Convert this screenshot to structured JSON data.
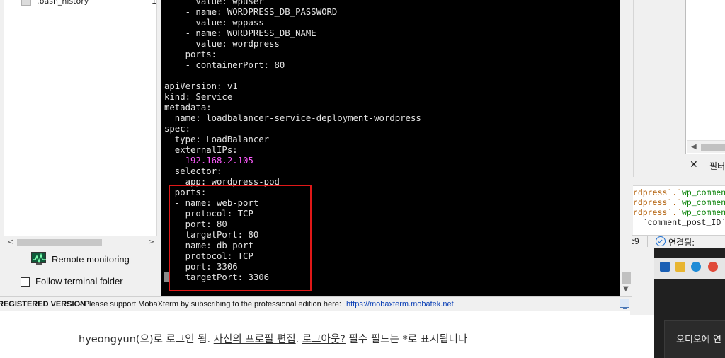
{
  "file_browser": {
    "row": {
      "name": ".bash_history",
      "size": "1"
    }
  },
  "sidebar": {
    "remote_monitoring": "Remote monitoring",
    "follow_terminal_folder": "Follow terminal folder",
    "follow_terminal_folder_checked": false
  },
  "terminal": {
    "lines": [
      "      value: wpuser",
      "    - name: WORDPRESS_DB_PASSWORD",
      "      value: wppass",
      "    - name: WORDPRESS_DB_NAME",
      "      value: wordpress",
      "    ports:",
      "    - containerPort: 80",
      "---",
      "apiVersion: v1",
      "kind: Service",
      "metadata:",
      "  name: loadbalancer-service-deployment-wordpress",
      "spec:",
      "  type: LoadBalancer",
      "  externalIPs:",
      "  - ",
      "  selector:",
      "    app: wordpress-pod",
      "  ports:",
      "  - name: web-port",
      "    protocol: TCP",
      "    port: 80",
      "    targetPort: 80",
      "  - name: db-port",
      "    protocol: TCP",
      "    port: 3306",
      "    targetPort: 3306"
    ],
    "external_ip": "192.168.2.105"
  },
  "statusbar": {
    "registered": "REGISTERED VERSION",
    "message": " -  Please support MobaXterm by subscribing to the professional edition here:",
    "url": "https://mobaxterm.mobatek.net"
  },
  "background_app": {
    "filter_label": "필터",
    "close_glyph": "✕",
    "sql_lines": [
      {
        "pre": "rdpress`.`",
        "tbl": "wp_commen"
      },
      {
        "pre": "rdpress`.`",
        "tbl": "wp_commen"
      },
      {
        "pre": "rdpress`.`",
        "tbl": "wp_commen"
      },
      {
        "pre": "  `comment_post_ID`",
        "tbl": ""
      }
    ],
    "status_left": "c9",
    "status_connected": "연결됨:",
    "audio_popup": "오디오에 연"
  },
  "web_page": {
    "login_text": "hyeongyun(으)로 로그인 됨. ",
    "edit_profile": "자신의 프로필 편집",
    "sep": ". ",
    "logout": "로그아웃?",
    "required_note": " 필수 필드는 *로 표시됩니다"
  },
  "colors": {
    "terminal_bg": "#000000",
    "terminal_fg": "#e4e4e4",
    "ip_highlight": "#ff5cff",
    "annotation_box": "#e01818",
    "link": "#0a3fb5"
  }
}
